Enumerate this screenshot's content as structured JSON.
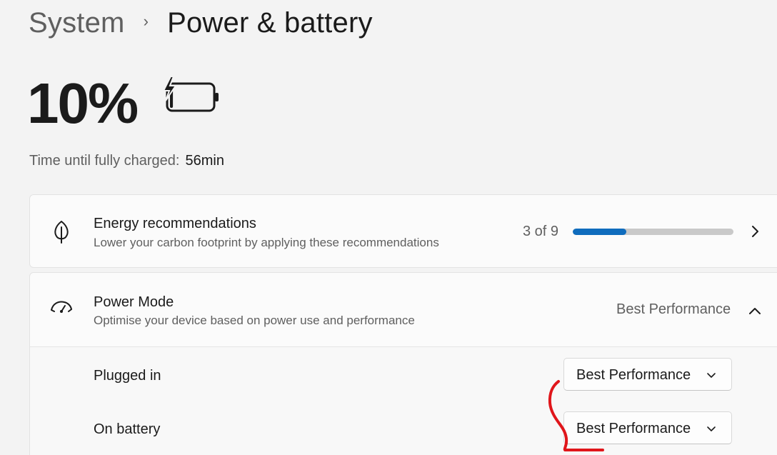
{
  "breadcrumb": {
    "parent": "System",
    "separator": "›",
    "current": "Power & battery"
  },
  "battery": {
    "percent": "10%",
    "charge_level": 0.1,
    "charging": true,
    "icon": "battery-charging-icon"
  },
  "charge_status": {
    "label": "Time until fully charged:",
    "value": "56min"
  },
  "energy_recommendations": {
    "title": "Energy recommendations",
    "subtitle": "Lower your carbon footprint by applying these recommendations",
    "progress_text": "3 of 9",
    "progress_fraction": 0.3333,
    "icon": "leaf-icon",
    "accent_color": "#0f6cbd"
  },
  "power_mode": {
    "title": "Power Mode",
    "subtitle": "Optimise your device based on power use and performance",
    "current_value": "Best Performance",
    "icon": "gauge-icon",
    "expanded": true,
    "settings": [
      {
        "label": "Plugged in",
        "selected": "Best Performance"
      },
      {
        "label": "On battery",
        "selected": "Best Performance"
      }
    ]
  },
  "annotation_color": "#e0161b"
}
